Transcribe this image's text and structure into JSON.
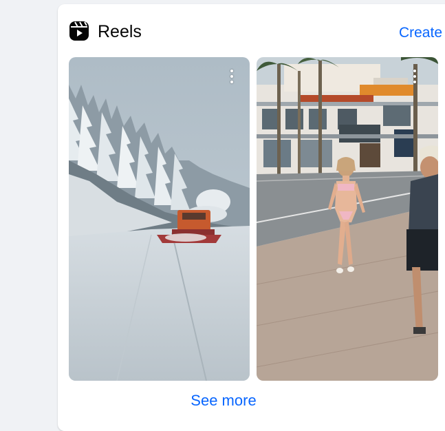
{
  "reels_section": {
    "title": "Reels",
    "create_label": "Create",
    "see_more_label": "See more",
    "icon": "reels-icon",
    "accent_color": "#0866ff"
  },
  "reels": [
    {
      "scene": "snow-plow-in-snowy-forest",
      "more_icon": "more-options-icon"
    },
    {
      "scene": "woman-walking-on-city-sidewalk",
      "more_icon": "more-options-icon"
    }
  ]
}
